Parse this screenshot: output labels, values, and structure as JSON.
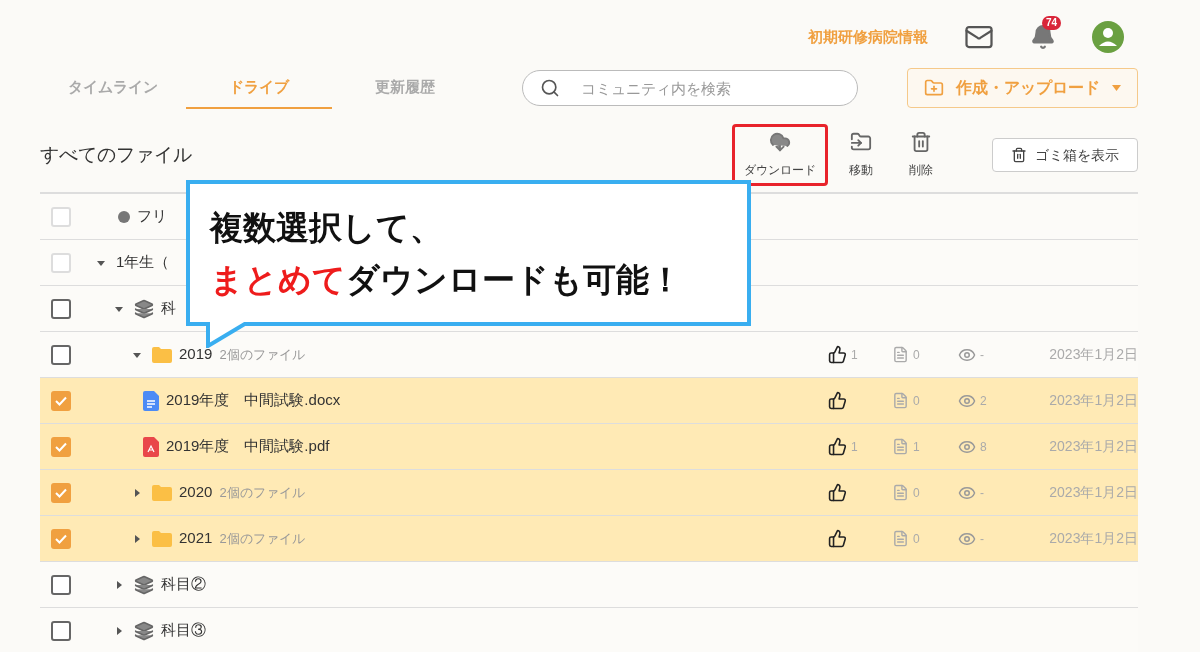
{
  "header": {
    "link": "初期研修病院情報",
    "notification_count": "74"
  },
  "tabs": [
    {
      "label": "タイムライン",
      "selected": false
    },
    {
      "label": "ドライブ",
      "selected": true
    },
    {
      "label": "更新履歴",
      "selected": false
    }
  ],
  "search": {
    "placeholder": "コミュニティ内を検索"
  },
  "create_button": {
    "label": "作成・アップロード"
  },
  "title": "すべてのファイル",
  "actions": [
    {
      "kind": "download",
      "label": "ダウンロード",
      "highlighted": true
    },
    {
      "kind": "move",
      "label": "移動",
      "highlighted": false
    },
    {
      "kind": "delete",
      "label": "削除",
      "highlighted": false
    }
  ],
  "trash_button": {
    "label": "ゴミ箱を表示"
  },
  "tree": [
    {
      "kind": "dot",
      "name": "フリ",
      "checked": false,
      "disabled": true
    },
    {
      "kind": "plain",
      "name": "1年生（",
      "checked": false,
      "disabled": true,
      "expanded": true,
      "children": [
        {
          "kind": "layers",
          "name": "科",
          "checked": false,
          "disabled": false,
          "expanded": true,
          "children": [
            {
              "kind": "folder",
              "name": "2019",
              "count": "2個のファイル",
              "checked": false,
              "disabled": false,
              "expanded": true,
              "likes": "1",
              "comments": "0",
              "views": "-",
              "date": "2023年1月2日",
              "children": [
                {
                  "kind": "docx",
                  "name": "2019年度　中間試験.docx",
                  "checked": true,
                  "disabled": false,
                  "comments": "0",
                  "views": "2",
                  "date": "2023年1月2日"
                },
                {
                  "kind": "pdf",
                  "name": "2019年度　中間試験.pdf",
                  "checked": true,
                  "disabled": false,
                  "likes": "1",
                  "comments": "1",
                  "views": "8",
                  "date": "2023年1月2日"
                }
              ]
            },
            {
              "kind": "folder",
              "name": "2020",
              "count": "2個のファイル",
              "checked": true,
              "disabled": false,
              "expanded": false,
              "comments": "0",
              "views": "-",
              "date": "2023年1月2日"
            },
            {
              "kind": "folder",
              "name": "2021",
              "count": "2個のファイル",
              "checked": true,
              "disabled": false,
              "expanded": false,
              "comments": "0",
              "views": "-",
              "date": "2023年1月2日"
            }
          ]
        },
        {
          "kind": "layers",
          "name": "科目②",
          "checked": false,
          "disabled": false,
          "expanded": false
        },
        {
          "kind": "layers",
          "name": "科目③",
          "checked": false,
          "disabled": false,
          "expanded": false
        }
      ]
    }
  ],
  "callout": {
    "line_1": "複数選択して、",
    "highlight": "まとめて",
    "line_2": "ダウンロードも可能！"
  }
}
